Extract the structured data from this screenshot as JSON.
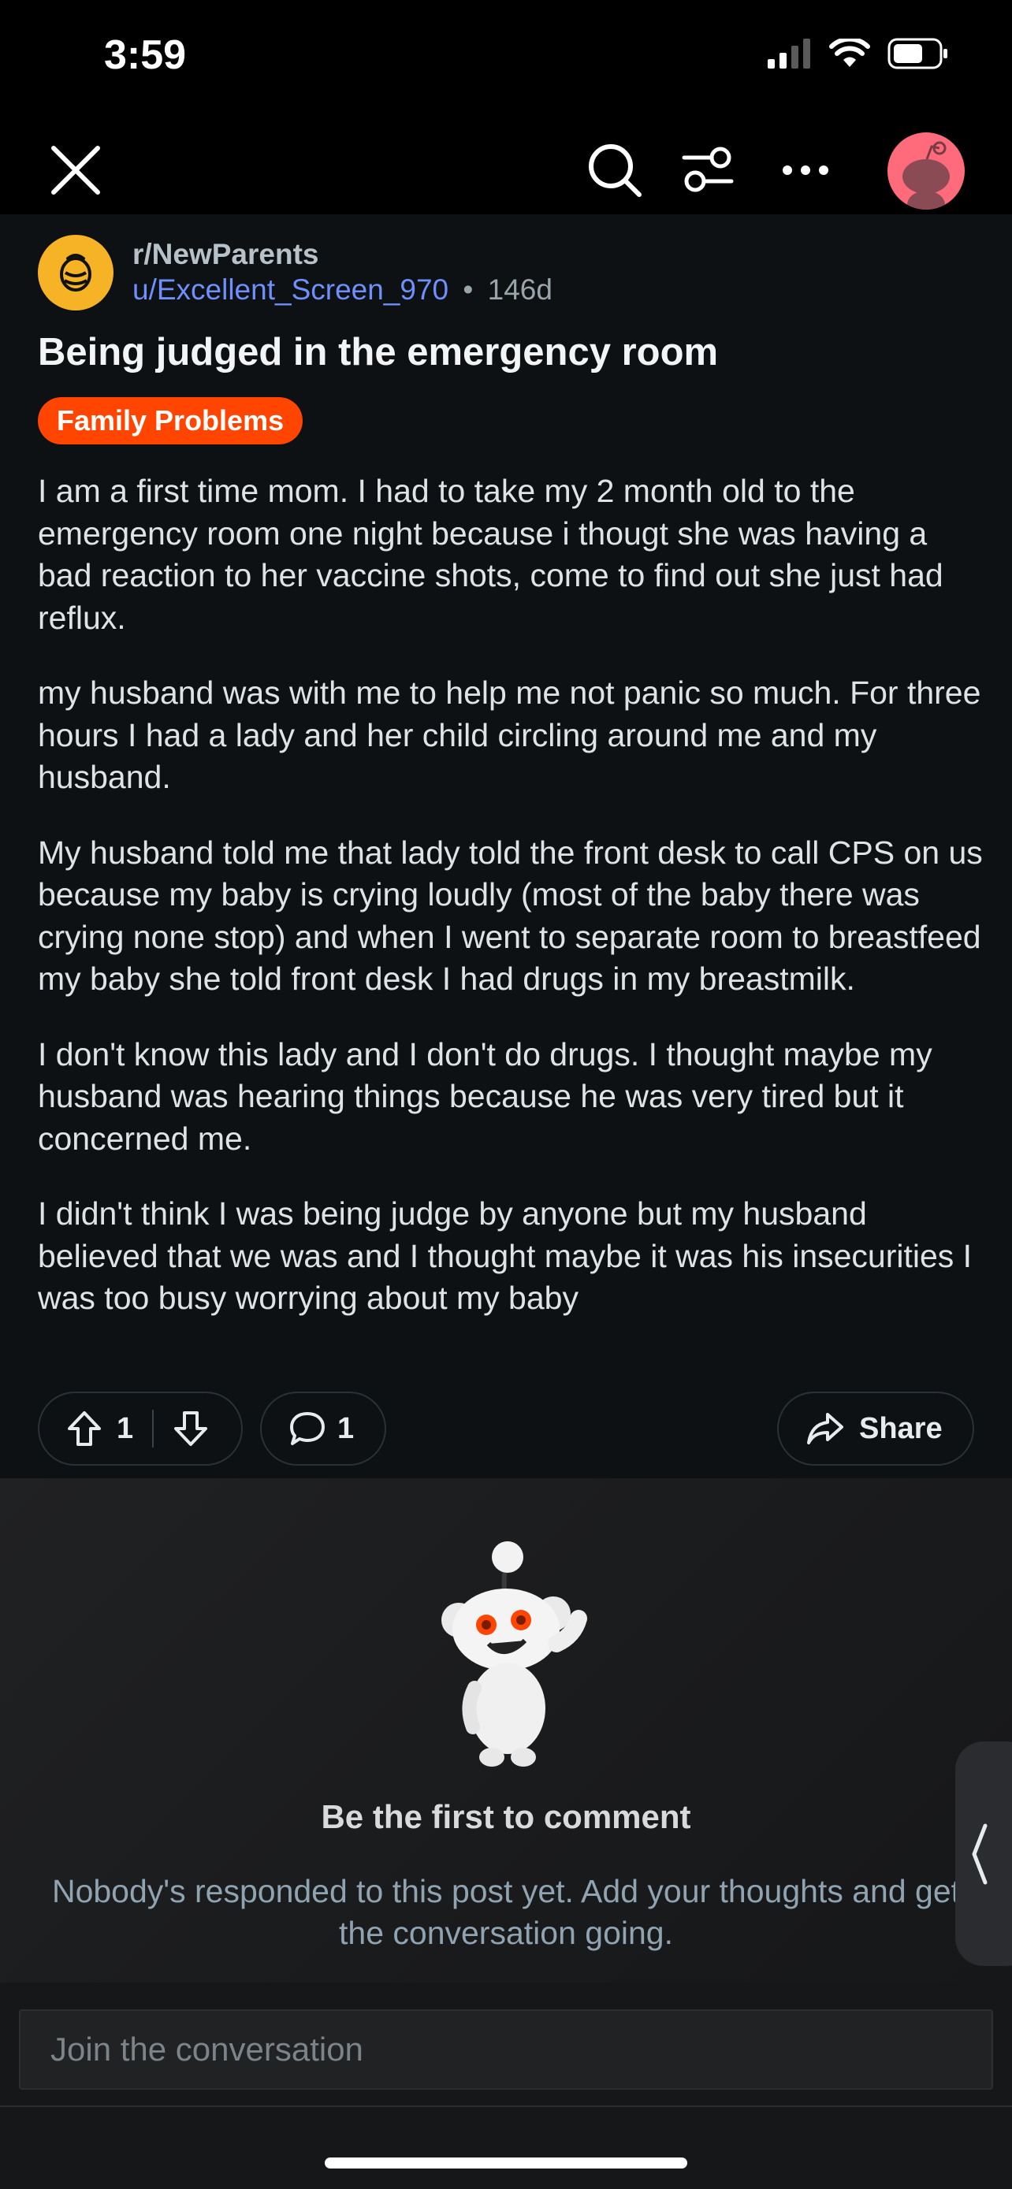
{
  "status_bar": {
    "time": "3:59"
  },
  "post": {
    "subreddit": "r/NewParents",
    "author": "u/Excellent_Screen_970",
    "age": "146d",
    "separator": "•",
    "title": "Being judged in the emergency room",
    "flair": "Family Problems",
    "paragraphs": [
      "I am a first time mom. I had to take my 2 month old to the emergency room one night because i thougt she was having a bad reaction to her vaccine shots, come to find out she just had reflux.",
      "my husband was with me to help me not panic so much. For three hours I had a lady and her child circling around me and my husband.",
      "My husband told me that lady told the front desk to call CPS on us because my baby is crying loudly (most of the baby there was crying none stop) and when I went to separate room to breastfeed my baby she told front desk I had drugs in my breastmilk.",
      "I don't know this lady and I don't do drugs. I thought maybe my husband was hearing things because he was very tired but it concerned me.",
      "I didn't think I was being judge by anyone but my husband believed that we was and I thought maybe it was his insecurities I was too busy worrying about my baby"
    ],
    "votes": "1",
    "comments": "1",
    "share_label": "Share"
  },
  "comments_empty": {
    "title": "Be the first to comment",
    "text": "Nobody's responded to this post yet. Add your thoughts and get the conversation going."
  },
  "compose": {
    "placeholder": "Join the conversation"
  },
  "colors": {
    "accent": "#ff4500",
    "link": "#6e8ffc",
    "background": "#0e1113"
  }
}
